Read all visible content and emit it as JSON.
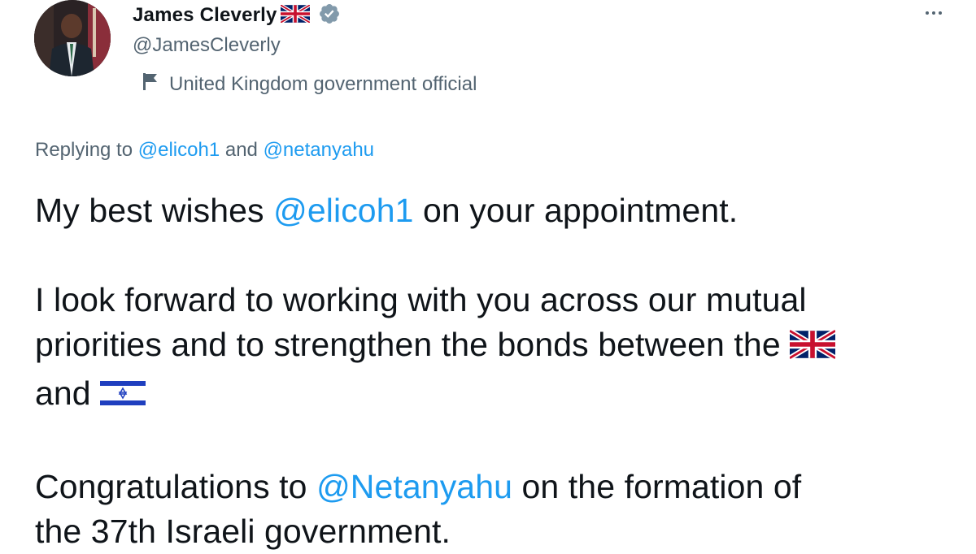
{
  "author": {
    "display_name": "James Cleverly",
    "name_flag": "🇬🇧",
    "handle": "@JamesCleverly",
    "label": "United Kingdom government official",
    "verified_icon": "verified-badge-icon",
    "label_icon": "government-flag-icon"
  },
  "reply_context": {
    "prefix": "Replying to",
    "handle1": "@elicoh1",
    "joiner": "and",
    "handle2": "@netanyahu"
  },
  "tweet": {
    "p1_before": "My best wishes",
    "p1_mention": "@elicoh1",
    "p1_after": "on your appointment.",
    "p2_line1": "I look forward to working with you across our mutual",
    "p2_line2_before": "priorities and to strengthen the bonds between the",
    "p2_flag1": "🇬🇧",
    "p2_line3_before": "and",
    "p2_flag2": "🇮🇱",
    "p3_before": "Congratulations to",
    "p3_mention": "@Netanyahu",
    "p3_after": "on the formation of",
    "p3_line2": "the 37th Israeli government."
  },
  "actions": {
    "more_icon": "more-options-icon"
  },
  "colors": {
    "link": "#1d9bf0",
    "secondary_text": "#536471",
    "primary_text": "#0f1419",
    "verified": "#829aab"
  }
}
